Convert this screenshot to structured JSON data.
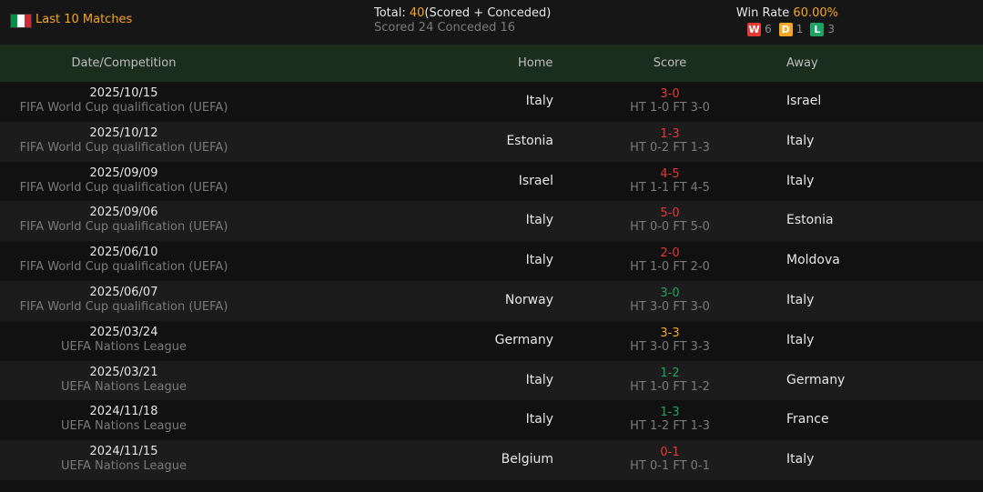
{
  "header_bar": {
    "title": "Last 10 Matches",
    "total_prefix": "Total: ",
    "total_value": "40",
    "total_suffix": "(Scored + Conceded)",
    "scored_conceded": "Scored 24 Conceded 16",
    "win_rate_label": "Win Rate ",
    "win_rate_value": "60.00%",
    "wins_label": "W",
    "wins": "6",
    "draws_label": "D",
    "draws": "1",
    "losses_label": "L",
    "losses": "3"
  },
  "columns": {
    "date": "Date/Competition",
    "home": "Home",
    "score": "Score",
    "away": "Away"
  },
  "colors": {
    "win": "#e53935",
    "draw": "#f5a623",
    "loss": "#1ea362",
    "accent": "#f5a623"
  },
  "matches": [
    {
      "date": "2025/10/15",
      "competition": "FIFA World Cup qualification (UEFA)",
      "home": "Italy",
      "score": "3-0",
      "result": "win",
      "ht_ft": "HT 1-0 FT 3-0",
      "away": "Israel"
    },
    {
      "date": "2025/10/12",
      "competition": "FIFA World Cup qualification (UEFA)",
      "home": "Estonia",
      "score": "1-3",
      "result": "win",
      "ht_ft": "HT 0-2 FT 1-3",
      "away": "Italy"
    },
    {
      "date": "2025/09/09",
      "competition": "FIFA World Cup qualification (UEFA)",
      "home": "Israel",
      "score": "4-5",
      "result": "win",
      "ht_ft": "HT 1-1 FT 4-5",
      "away": "Italy"
    },
    {
      "date": "2025/09/06",
      "competition": "FIFA World Cup qualification (UEFA)",
      "home": "Italy",
      "score": "5-0",
      "result": "win",
      "ht_ft": "HT 0-0 FT 5-0",
      "away": "Estonia"
    },
    {
      "date": "2025/06/10",
      "competition": "FIFA World Cup qualification (UEFA)",
      "home": "Italy",
      "score": "2-0",
      "result": "win",
      "ht_ft": "HT 1-0 FT 2-0",
      "away": "Moldova"
    },
    {
      "date": "2025/06/07",
      "competition": "FIFA World Cup qualification (UEFA)",
      "home": "Norway",
      "score": "3-0",
      "result": "loss",
      "ht_ft": "HT 3-0 FT 3-0",
      "away": "Italy"
    },
    {
      "date": "2025/03/24",
      "competition": "UEFA Nations League",
      "home": "Germany",
      "score": "3-3",
      "result": "draw",
      "ht_ft": "HT 3-0 FT 3-3",
      "away": "Italy"
    },
    {
      "date": "2025/03/21",
      "competition": "UEFA Nations League",
      "home": "Italy",
      "score": "1-2",
      "result": "loss",
      "ht_ft": "HT 1-0 FT 1-2",
      "away": "Germany"
    },
    {
      "date": "2024/11/18",
      "competition": "UEFA Nations League",
      "home": "Italy",
      "score": "1-3",
      "result": "loss",
      "ht_ft": "HT 1-2 FT 1-3",
      "away": "France"
    },
    {
      "date": "2024/11/15",
      "competition": "UEFA Nations League",
      "home": "Belgium",
      "score": "0-1",
      "result": "win",
      "ht_ft": "HT 0-1 FT 0-1",
      "away": "Italy"
    }
  ]
}
